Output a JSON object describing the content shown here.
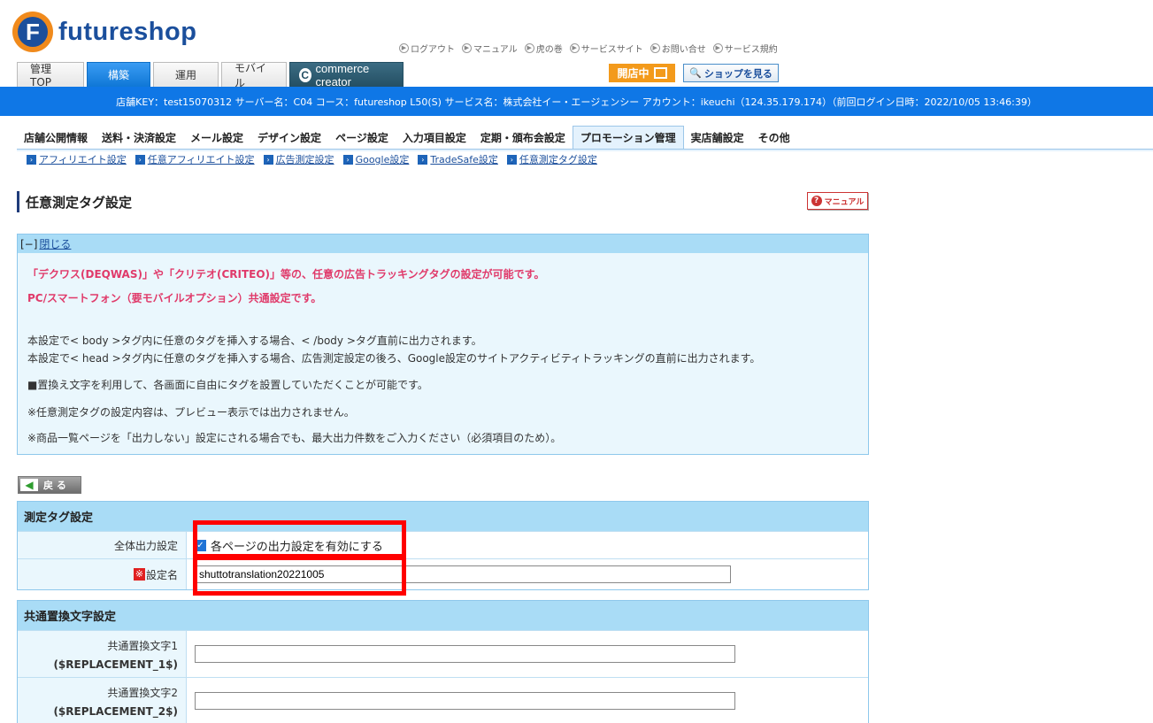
{
  "logo": {
    "letter": "F",
    "text": "futureshop"
  },
  "top_links": [
    "ログアウト",
    "マニュアル",
    "虎の巻",
    "サービスサイト",
    "お問い合せ",
    "サービス規約"
  ],
  "main_tabs": [
    "管理TOP",
    "構築",
    "運用",
    "モバイル",
    "commerce creator"
  ],
  "open_badge": "開店中",
  "shop_button": "ショップを見る",
  "info_bar": "店舗KEY：test15070312 サーバー名：C04 コース：futureshop L50(S) サービス名：株式会社イー・エージェンシー アカウント：ikeuchi（124.35.179.174）（前回ログイン日時：2022/10/05 13:46:39）",
  "sub_nav": [
    "店舗公開情報",
    "送料・決済設定",
    "メール設定",
    "デザイン設定",
    "ページ設定",
    "入力項目設定",
    "定期・頒布会設定",
    "プロモーション管理",
    "実店舗設定",
    "その他"
  ],
  "sub_sub_nav": [
    "アフィリエイト設定",
    "任意アフィリエイト設定",
    "広告測定設定",
    "Google設定",
    "TradeSafe設定",
    "任意測定タグ設定"
  ],
  "page_title": "任意測定タグ設定",
  "manual_button": "マニュアル",
  "info_box": {
    "toggle": "[−]",
    "close_label": "閉じる",
    "red_lines": [
      "「デクワス(DEQWAS)」や「クリテオ(CRITEO)」等の、任意の広告トラッキングタグの設定が可能です。",
      "PC/スマートフォン（要モバイルオプション）共通設定です。"
    ],
    "lines": [
      "本設定で< body >タグ内に任意のタグを挿入する場合、< /body >タグ直前に出力されます。",
      "本設定で< head >タグ内に任意のタグを挿入する場合、広告測定設定の後ろ、Google設定のサイトアクティビティトラッキングの直前に出力されます。",
      "■置換え文字を利用して、各画面に自由にタグを設置していただくことが可能です。",
      "※任意測定タグの設定内容は、プレビュー表示では出力されません。",
      "※商品一覧ページを「出力しない」設定にされる場合でも、最大出力件数をご入力ください（必須項目のため）。"
    ]
  },
  "back_button": "戻 る",
  "tag_section": {
    "title": "測定タグ設定",
    "output_label": "全体出力設定",
    "output_checkbox_label": "各ページの出力設定を有効にする",
    "output_checked": true,
    "required_mark": "※",
    "name_label": "設定名",
    "name_value": "shuttotranslation20221005"
  },
  "replace_section": {
    "title": "共通置換文字設定",
    "rows": [
      {
        "label": "共通置換文字1",
        "code": "($REPLACEMENT_1$)",
        "value": ""
      },
      {
        "label": "共通置換文字2",
        "code": "($REPLACEMENT_2$)",
        "value": ""
      }
    ]
  },
  "colors": {
    "accent": "#0f77e6",
    "highlight": "#ff0000",
    "logo_orange": "#f08a1c",
    "logo_blue": "#1b4f9c"
  }
}
